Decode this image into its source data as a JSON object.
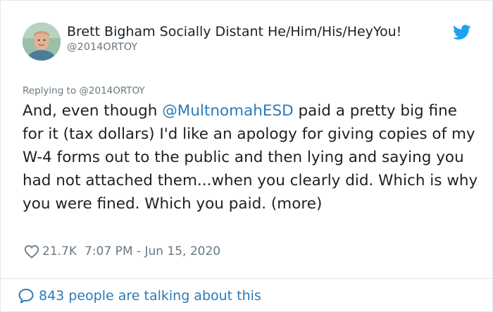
{
  "author": {
    "name": "Brett Bigham Socially Distant He/Him/His/HeyYou!",
    "handle": "@2014ORTOY"
  },
  "tweet": {
    "reply_prefix": "Replying to",
    "reply_handle": "@2014ORTOY",
    "text_before": "And, even though ",
    "mention": "@MultnomahESD",
    "text_after": "  paid a pretty big fine for it (tax dollars) I'd like an apology for giving copies of my W-4 forms out to the public and then lying and saying you had not attached them...when you clearly did. Which is why you were fined. Which you paid. (more)",
    "likes": "21.7K",
    "timestamp": "7:07 PM - Jun 15, 2020"
  },
  "footer": {
    "talking": "843 people are talking about this"
  },
  "colors": {
    "link": "#2b7bb9",
    "twitter_blue": "#1da1f2",
    "muted": "#697882"
  },
  "icons": {
    "brand": "twitter-bird-icon",
    "like": "heart-icon",
    "conversation": "speech-bubble-icon"
  }
}
